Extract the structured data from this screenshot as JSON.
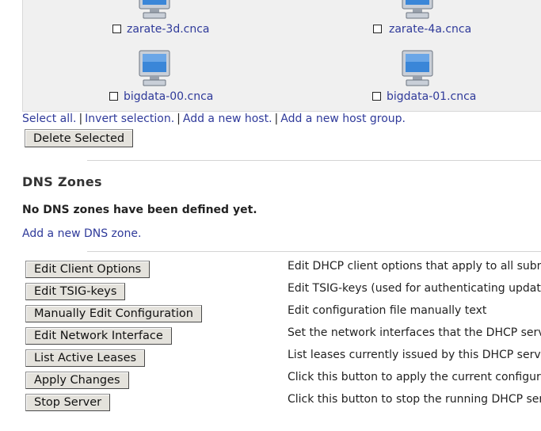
{
  "hosts": [
    {
      "name": "zarate-3d.cnca",
      "checked": false
    },
    {
      "name": "zarate-4a.cnca",
      "checked": false
    },
    {
      "name": "bigdata-00.cnca",
      "checked": false
    },
    {
      "name": "bigdata-01.cnca",
      "checked": false
    }
  ],
  "host_links": {
    "select_all": "Select all.",
    "invert_selection": "Invert selection.",
    "add_host": "Add a new host.",
    "add_host_group": "Add a new host group.",
    "separator": "|"
  },
  "delete_selected": "Delete Selected",
  "dns_zones": {
    "title": "DNS Zones",
    "empty_message": "No DNS zones have been defined yet.",
    "add_link": "Add a new DNS zone."
  },
  "actions": [
    {
      "label": "Edit Client Options",
      "description": "Edit DHCP client options that apply to all subnets"
    },
    {
      "label": "Edit TSIG-keys",
      "description": "Edit TSIG-keys (used for authenticating updates t"
    },
    {
      "label": "Manually Edit Configuration",
      "description": "Edit configuration file manually text"
    },
    {
      "label": "Edit Network Interface",
      "description": "Set the network interfaces that the DHCP server l"
    },
    {
      "label": "List Active Leases",
      "description": "List leases currently issued by this DHCP server f"
    },
    {
      "label": "Apply Changes",
      "description": "Click this button to apply the current configuratio"
    },
    {
      "label": "Stop Server",
      "description": "Click this button to stop the running DHCP server"
    }
  ],
  "colors": {
    "link": "#2f3a9a",
    "panel_bg": "#f0f0f0",
    "button_bg": "#e4e2dc"
  },
  "icons": {
    "host": "computer-monitor-icon"
  }
}
